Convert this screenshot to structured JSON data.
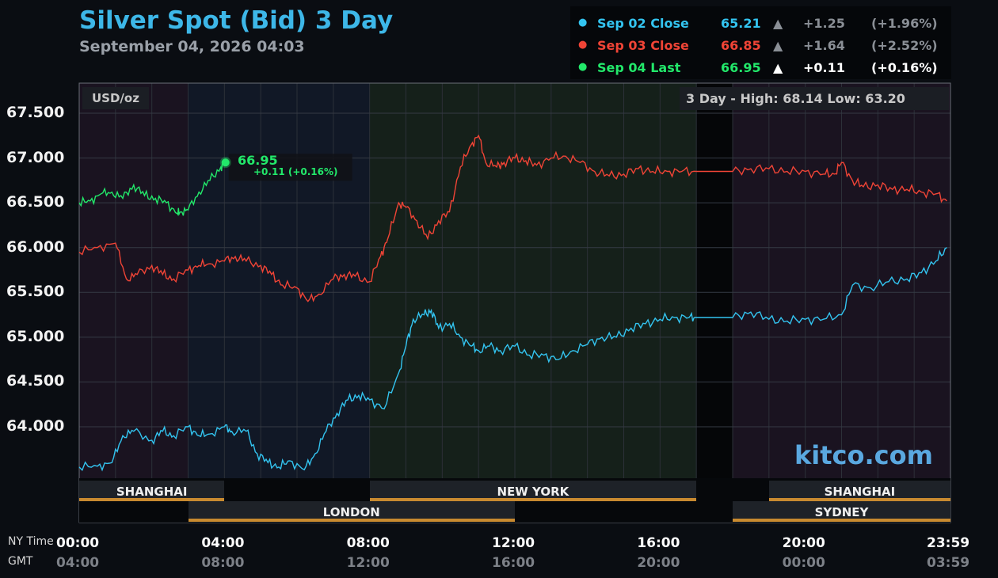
{
  "header": {
    "title": "Silver Spot (Bid) 3 Day",
    "subtitle": "September 04, 2026 04:03"
  },
  "legend": [
    {
      "name": "Sep 02 Close",
      "value": "65.21",
      "arrow": "▲",
      "change": "+1.25",
      "pct": "(+1.96%)",
      "color": "#33c4f0",
      "dim": true
    },
    {
      "name": "Sep 03 Close",
      "value": "66.85",
      "arrow": "▲",
      "change": "+1.64",
      "pct": "(+2.52%)",
      "color": "#f04436",
      "dim": true
    },
    {
      "name": "Sep 04 Last",
      "value": "66.95",
      "arrow": "▲",
      "change": "+0.11",
      "pct": "(+0.16%)",
      "color": "#22e86a",
      "dim": false
    }
  ],
  "unit_label": "USD/oz",
  "high_low": "3 Day - High: 68.14  Low: 63.20",
  "watermark": "kitco.com",
  "tooltip": {
    "value": "66.95",
    "change": "+0.11 (+0.16%)"
  },
  "time_labels": {
    "ny": "NY Time",
    "gmt": "GMT"
  },
  "sessions": [
    {
      "name": "SHANGHAI",
      "start": 0,
      "end": 4,
      "row": 0
    },
    {
      "name": "NEW YORK",
      "start": 8,
      "end": 17,
      "row": 0
    },
    {
      "name": "SHANGHAI",
      "start": 19,
      "end": 24,
      "row": 0
    },
    {
      "name": "LONDON",
      "start": 3,
      "end": 12,
      "row": 1
    },
    {
      "name": "SYDNEY",
      "start": 18,
      "end": 24,
      "row": 1
    }
  ],
  "colors": {
    "sep02": "#33c4f0",
    "sep03": "#f04436",
    "sep04": "#22e86a",
    "title": "#3db7e8",
    "session_bar": "#c88a30"
  },
  "chart_data": {
    "type": "line",
    "ylim": [
      63.0,
      67.85
    ],
    "xlim": [
      0,
      24
    ],
    "y_ticks": [
      "67.500",
      "67.000",
      "66.500",
      "66.000",
      "65.500",
      "65.000",
      "64.500",
      "64.000"
    ],
    "y_tick_values": [
      67.5,
      67.0,
      66.5,
      66.0,
      65.5,
      65.0,
      64.5,
      64.0
    ],
    "x_ticks_ny": [
      "00:00",
      "04:00",
      "08:00",
      "12:00",
      "16:00",
      "20:00",
      "23:59"
    ],
    "x_ticks_gmt": [
      "04:00",
      "08:00",
      "12:00",
      "16:00",
      "20:00",
      "00:00",
      "03:59"
    ],
    "x_tick_hours": [
      0,
      4,
      8,
      12,
      16,
      20,
      24
    ],
    "series": [
      {
        "name": "Sep 02 Close",
        "key": "sep02",
        "x": [
          0,
          0.5,
          0.9,
          1.2,
          1.5,
          2.0,
          2.3,
          2.6,
          3.0,
          3.3,
          3.6,
          4.0,
          4.2,
          4.6,
          4.9,
          5.2,
          5.5,
          5.8,
          6.2,
          6.5,
          6.8,
          7.1,
          7.4,
          7.7,
          8.0,
          8.4,
          8.8,
          9.0,
          9.2,
          9.5,
          9.7,
          9.9,
          10.2,
          10.5,
          10.8,
          11.0,
          11.3,
          11.6,
          12.0,
          12.4,
          12.8,
          13.2,
          13.6,
          14.0,
          14.4,
          14.8,
          15.2,
          15.6,
          16.0,
          16.4,
          16.8,
          17.0,
          18.0,
          18.5,
          19.0,
          19.5,
          20.0,
          20.5,
          21.0,
          21.3,
          21.8,
          22.3,
          22.8,
          23.2,
          23.6,
          23.9
        ],
        "y": [
          63.55,
          63.56,
          63.6,
          63.9,
          63.95,
          63.85,
          63.95,
          63.9,
          64.0,
          63.9,
          63.92,
          64.0,
          63.95,
          63.95,
          63.7,
          63.6,
          63.55,
          63.62,
          63.52,
          63.7,
          63.95,
          64.15,
          64.3,
          64.35,
          64.3,
          64.2,
          64.6,
          64.9,
          65.2,
          65.25,
          65.3,
          65.1,
          65.15,
          65.0,
          64.9,
          64.85,
          64.9,
          64.85,
          64.9,
          64.8,
          64.8,
          64.75,
          64.85,
          64.92,
          65.0,
          65.0,
          65.1,
          65.15,
          65.2,
          65.22,
          65.22,
          65.22,
          65.22,
          65.28,
          65.2,
          65.18,
          65.2,
          65.2,
          65.25,
          65.58,
          65.55,
          65.62,
          65.65,
          65.72,
          65.85,
          66.0
        ]
      },
      {
        "name": "Sep 03 Close",
        "key": "sep03",
        "x": [
          0,
          0.5,
          1.0,
          1.3,
          1.6,
          2.0,
          2.3,
          2.6,
          3.0,
          3.3,
          3.6,
          4.0,
          4.3,
          4.6,
          5.0,
          5.3,
          5.6,
          6.0,
          6.3,
          6.6,
          7.0,
          7.3,
          7.6,
          8.0,
          8.3,
          8.5,
          8.8,
          9.0,
          9.3,
          9.6,
          9.9,
          10.2,
          10.5,
          10.8,
          11.0,
          11.2,
          11.5,
          11.7,
          12.0,
          12.3,
          12.6,
          13.0,
          13.4,
          13.8,
          14.2,
          14.6,
          15.0,
          15.4,
          15.8,
          16.2,
          16.6,
          17.0,
          18.0,
          18.5,
          19.0,
          19.5,
          20.0,
          20.5,
          20.8,
          21.0,
          21.3,
          21.6,
          22.0,
          22.4,
          22.8,
          23.2,
          23.6,
          23.9
        ],
        "y": [
          65.95,
          66.0,
          66.05,
          65.65,
          65.7,
          65.8,
          65.7,
          65.65,
          65.75,
          65.8,
          65.82,
          65.85,
          65.9,
          65.85,
          65.8,
          65.7,
          65.58,
          65.55,
          65.4,
          65.48,
          65.65,
          65.7,
          65.68,
          65.62,
          65.9,
          66.1,
          66.5,
          66.45,
          66.3,
          66.1,
          66.3,
          66.4,
          66.9,
          67.15,
          67.25,
          66.95,
          66.9,
          66.95,
          67.0,
          66.97,
          66.92,
          67.0,
          67.02,
          66.95,
          66.85,
          66.8,
          66.82,
          66.88,
          66.85,
          66.85,
          66.85,
          66.85,
          66.85,
          66.88,
          66.88,
          66.85,
          66.85,
          66.82,
          66.82,
          66.95,
          66.75,
          66.68,
          66.7,
          66.65,
          66.65,
          66.62,
          66.6,
          66.52
        ]
      },
      {
        "name": "Sep 04 Last",
        "key": "sep04",
        "x": [
          0,
          0.3,
          0.6,
          0.9,
          1.2,
          1.5,
          1.8,
          2.1,
          2.4,
          2.7,
          2.8,
          3.0,
          3.3,
          3.6,
          3.9,
          4.03
        ],
        "y": [
          66.5,
          66.52,
          66.6,
          66.62,
          66.55,
          66.7,
          66.58,
          66.55,
          66.5,
          66.38,
          66.4,
          66.42,
          66.62,
          66.75,
          66.9,
          66.95
        ]
      }
    ]
  }
}
